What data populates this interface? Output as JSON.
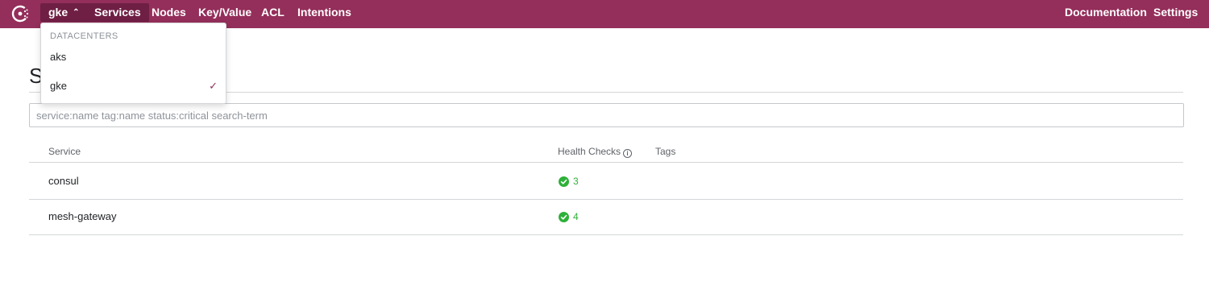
{
  "header": {
    "datacenter": "gke",
    "nav": [
      {
        "label": "Services"
      },
      {
        "label": "Nodes"
      },
      {
        "label": "Key/Value"
      },
      {
        "label": "ACL"
      },
      {
        "label": "Intentions"
      }
    ],
    "right": [
      {
        "label": "Documentation"
      },
      {
        "label": "Settings"
      }
    ]
  },
  "dropdown": {
    "header": "DATACENTERS",
    "items": [
      {
        "label": "aks"
      },
      {
        "label": "gke",
        "selected": true
      }
    ]
  },
  "page": {
    "title": "S"
  },
  "search": {
    "placeholder": "service:name tag:name status:critical search-term"
  },
  "table": {
    "columns": {
      "service": "Service",
      "health": "Health Checks",
      "tags": "Tags"
    },
    "rows": [
      {
        "name": "consul",
        "passing": "3"
      },
      {
        "name": "mesh-gateway",
        "passing": "4"
      }
    ]
  },
  "colors": {
    "brand": "#942e5a",
    "active": "#6f1f44",
    "passing": "#2eb039"
  }
}
